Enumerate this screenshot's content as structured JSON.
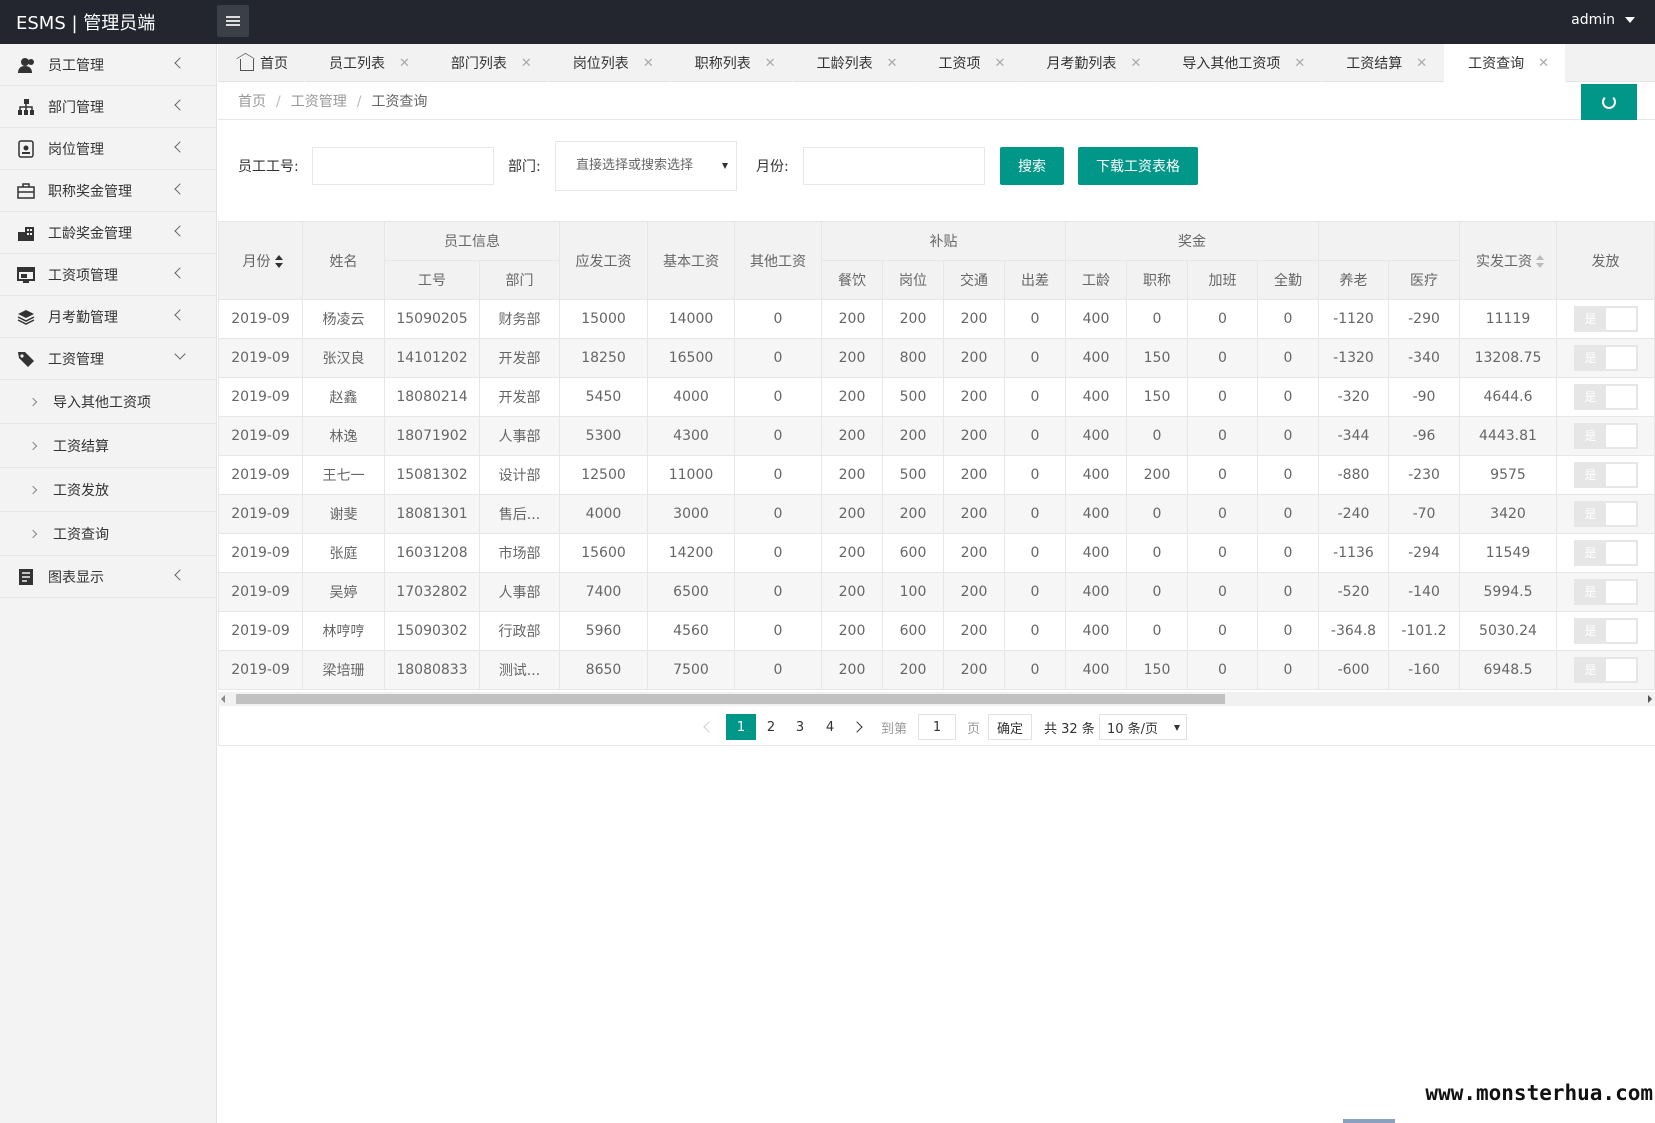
{
  "header": {
    "logo": "ESMS | 管理员端",
    "user": "admin"
  },
  "sidebar": {
    "items": [
      {
        "label": "员工管理",
        "icon": "users-icon"
      },
      {
        "label": "部门管理",
        "icon": "sitemap-icon"
      },
      {
        "label": "岗位管理",
        "icon": "id-badge-icon"
      },
      {
        "label": "职称奖金管理",
        "icon": "briefcase-icon"
      },
      {
        "label": "工龄奖金管理",
        "icon": "building-icon"
      },
      {
        "label": "工资项管理",
        "icon": "window-icon"
      },
      {
        "label": "月考勤管理",
        "icon": "layers-icon"
      },
      {
        "label": "工资管理",
        "icon": "tag-icon"
      }
    ],
    "subitems": [
      "导入其他工资项",
      "工资结算",
      "工资发放",
      "工资查询"
    ],
    "last": {
      "label": "图表显示",
      "icon": "chart-icon"
    }
  },
  "tabs": [
    {
      "label": "首页"
    },
    {
      "label": "员工列表"
    },
    {
      "label": "部门列表"
    },
    {
      "label": "岗位列表"
    },
    {
      "label": "职称列表"
    },
    {
      "label": "工龄列表"
    },
    {
      "label": "工资项"
    },
    {
      "label": "月考勤列表"
    },
    {
      "label": "导入其他工资项"
    },
    {
      "label": "工资结算"
    },
    {
      "label": "工资查询"
    }
  ],
  "close_glyph": "✕",
  "breadcrumb": {
    "home": "首页",
    "level2": "工资管理",
    "current": "工资查询",
    "sep": "/"
  },
  "search": {
    "emp_label": "员工工号:",
    "dept_label": "部门:",
    "dept_value": "直接选择或搜索选择",
    "month_label": "月份:",
    "search_btn": "搜索",
    "download_btn": "下载工资表格"
  },
  "table": {
    "h": {
      "month": "月份",
      "name": "姓名",
      "empinfo": "员工信息",
      "empno": "工号",
      "dept": "部门",
      "gross": "应发工资",
      "base": "基本工资",
      "other": "其他工资",
      "allowance": "补贴",
      "meal": "餐饮",
      "post": "岗位",
      "traffic": "交通",
      "trip": "出差",
      "bonus": "奖金",
      "seniority": "工龄",
      "title": "职称",
      "overtime": "加班",
      "attendance": "全勤",
      "pension": "养老",
      "medical": "医疗",
      "net": "实发工资",
      "issued": "发放"
    },
    "switch_label": "是",
    "rows": [
      [
        "2019-09",
        "杨凌云",
        "15090205",
        "财务部",
        "15000",
        "14000",
        "0",
        "200",
        "200",
        "200",
        "0",
        "400",
        "0",
        "0",
        "0",
        "-1120",
        "-290",
        "11119"
      ],
      [
        "2019-09",
        "张汉良",
        "14101202",
        "开发部",
        "18250",
        "16500",
        "0",
        "200",
        "800",
        "200",
        "0",
        "400",
        "150",
        "0",
        "0",
        "-1320",
        "-340",
        "13208.75"
      ],
      [
        "2019-09",
        "赵鑫",
        "18080214",
        "开发部",
        "5450",
        "4000",
        "0",
        "200",
        "500",
        "200",
        "0",
        "400",
        "150",
        "0",
        "0",
        "-320",
        "-90",
        "4644.6"
      ],
      [
        "2019-09",
        "林逸",
        "18071902",
        "人事部",
        "5300",
        "4300",
        "0",
        "200",
        "200",
        "200",
        "0",
        "400",
        "0",
        "0",
        "0",
        "-344",
        "-96",
        "4443.81"
      ],
      [
        "2019-09",
        "王七一",
        "15081302",
        "设计部",
        "12500",
        "11000",
        "0",
        "200",
        "500",
        "200",
        "0",
        "400",
        "200",
        "0",
        "0",
        "-880",
        "-230",
        "9575"
      ],
      [
        "2019-09",
        "谢斐",
        "18081301",
        "售后...",
        "4000",
        "3000",
        "0",
        "200",
        "200",
        "200",
        "0",
        "400",
        "0",
        "0",
        "0",
        "-240",
        "-70",
        "3420"
      ],
      [
        "2019-09",
        "张庭",
        "16031208",
        "市场部",
        "15600",
        "14200",
        "0",
        "200",
        "600",
        "200",
        "0",
        "400",
        "0",
        "0",
        "0",
        "-1136",
        "-294",
        "11549"
      ],
      [
        "2019-09",
        "吴婷",
        "17032802",
        "人事部",
        "7400",
        "6500",
        "0",
        "200",
        "100",
        "200",
        "0",
        "400",
        "0",
        "0",
        "0",
        "-520",
        "-140",
        "5994.5"
      ],
      [
        "2019-09",
        "林哼哼",
        "15090302",
        "行政部",
        "5960",
        "4560",
        "0",
        "200",
        "600",
        "200",
        "0",
        "400",
        "0",
        "0",
        "0",
        "-364.8",
        "-101.2",
        "5030.24"
      ],
      [
        "2019-09",
        "梁培珊",
        "18080833",
        "测试...",
        "8650",
        "7500",
        "0",
        "200",
        "200",
        "200",
        "0",
        "400",
        "150",
        "0",
        "0",
        "-600",
        "-160",
        "6948.5"
      ]
    ]
  },
  "pager": {
    "pages": [
      "1",
      "2",
      "3",
      "4"
    ],
    "current": 1,
    "goto_label": "到第",
    "goto_value": "1",
    "page_unit": "页",
    "confirm": "确定",
    "total": "共 32 条",
    "page_size": "10 条/页"
  },
  "watermark": "www.monsterhua.com",
  "colors": {
    "primary": "#009688",
    "header": "#23262e",
    "sidebar": "#f3f3f3"
  }
}
